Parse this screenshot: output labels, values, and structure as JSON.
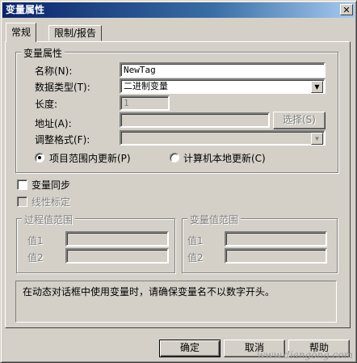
{
  "window": {
    "title": "变量属性",
    "close_symbol": "✕"
  },
  "tabs": [
    {
      "label": "常规",
      "active": true
    },
    {
      "label": "限制/报告",
      "active": false
    }
  ],
  "var_props": {
    "legend": "变量属性",
    "name_label": "名称(N):",
    "name_value": "NewTag",
    "type_label": "数据类型(T):",
    "type_value": "二进制变量",
    "length_label": "长度:",
    "length_value": "1",
    "address_label": "地址(A):",
    "address_value": "",
    "select_button": "选择(S)",
    "format_label": "调整格式(F):",
    "format_value": "",
    "radio_project": "项目范围内更新(P)",
    "radio_local": "计算机本地更新(C)"
  },
  "options": {
    "sync_label": "变量同步",
    "linear_label": "线性标定"
  },
  "process_range": {
    "legend": "过程值范围",
    "v1": "值1",
    "v2": "值2"
  },
  "tag_range": {
    "legend": "变量值范围",
    "v1": "值1",
    "v2": "值2"
  },
  "info_text": "在动态对话框中使用变量时，请确保变量名不以数字开头。",
  "buttons": {
    "ok": "确定",
    "cancel": "取消",
    "help": "帮助"
  },
  "watermark": "www.diangong.com"
}
